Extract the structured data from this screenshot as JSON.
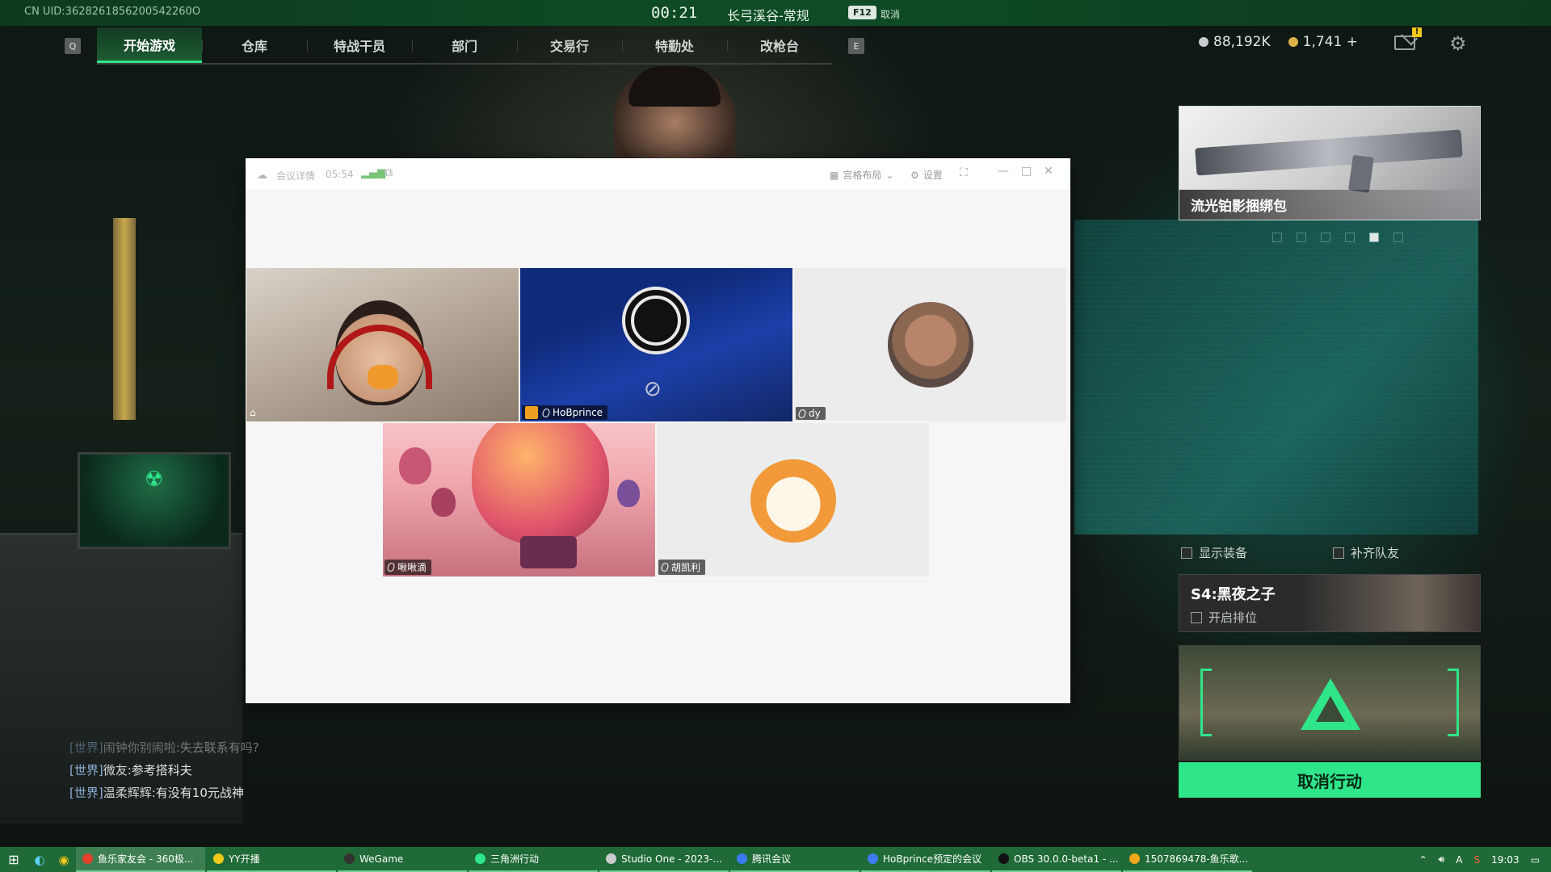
{
  "topbar": {
    "uid": "CN UID:3628261856200542260О",
    "timer": "00:21",
    "map": "长弓溪谷-常规",
    "key": "F12",
    "cancel": "取消"
  },
  "nav": {
    "left_key": "Q",
    "right_key": "E",
    "tabs": [
      {
        "label": "开始游戏",
        "active": true
      },
      {
        "label": "仓库"
      },
      {
        "label": "特战干员"
      },
      {
        "label": "部门"
      },
      {
        "label": "交易行"
      },
      {
        "label": "特勤处"
      },
      {
        "label": "改枪台"
      }
    ]
  },
  "currency": {
    "primary": "88,192K",
    "secondary": "1,741",
    "add": "+"
  },
  "mail_badge": "!",
  "promo": {
    "title": "流光铂影捆绑包"
  },
  "options": {
    "show_gear": "显示装备",
    "fill_team": "补齐队友"
  },
  "season": {
    "title": "S4:黑夜之子",
    "ranked": "开启排位"
  },
  "action": {
    "cancel": "取消行动"
  },
  "chat": [
    {
      "channel": "[世界]",
      "name": "闹钟你别闹啦:",
      "text": "失去联系有吗?",
      "faded": true
    },
    {
      "channel": "[世界]",
      "name": "微友:",
      "text": "参考搭科夫"
    },
    {
      "channel": "[世界]",
      "name": "温柔辉辉:",
      "text": "有没有10元战神"
    }
  ],
  "meeting": {
    "title": "会议详情",
    "time": "05:54",
    "layout": "宫格布局",
    "settings": "设置",
    "participants": [
      {
        "name": ""
      },
      {
        "name": "HoBprince",
        "host": true
      },
      {
        "name": "dy"
      },
      {
        "name": "啾啾滴"
      },
      {
        "name": "胡凯利"
      }
    ]
  },
  "taskbar": {
    "apps": [
      {
        "label": "鱼乐家友会 - 360极...",
        "color": "#e5412b",
        "active": true
      },
      {
        "label": "YY开播",
        "color": "#f2c81a"
      },
      {
        "label": "WeGame",
        "color": "#333333"
      },
      {
        "label": "三角洲行动",
        "color": "#2fe58a"
      },
      {
        "label": "Studio One - 2023-...",
        "color": "#cccccc"
      },
      {
        "label": "腾讯会议",
        "color": "#3b7cf6"
      },
      {
        "label": "HoBprince预定的会议",
        "color": "#3b7cf6"
      },
      {
        "label": "OBS 30.0.0-beta1 - ...",
        "color": "#111111"
      },
      {
        "label": "1507869478-鱼乐歌...",
        "color": "#f2a81a"
      }
    ],
    "clock": "19:03"
  },
  "colors": {
    "accent": "#2fe58a",
    "topbar": "#0f4d27",
    "taskbar": "#1f6a36"
  }
}
